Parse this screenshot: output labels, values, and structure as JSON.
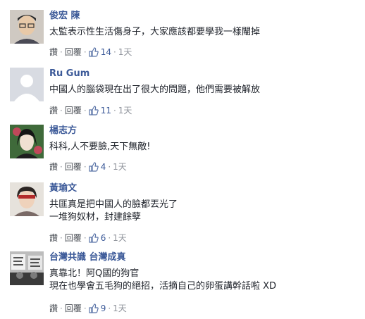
{
  "comments": [
    {
      "name": "俊宏 陳",
      "lines": [
        "太監表示性生活傷身子，大家應該都要學我一樣閹掉"
      ],
      "reply_label": "讚",
      "respond_label": "回覆",
      "likes": "14",
      "time": "1天"
    },
    {
      "name": "Ru Gum",
      "lines": [
        "中國人的腦袋現在出了很大的問題，他們需要被解放"
      ],
      "reply_label": "讚",
      "respond_label": "回覆",
      "likes": "11",
      "time": "1天"
    },
    {
      "name": "楊志方",
      "lines": [
        "科科,人不要臉,天下無敵!"
      ],
      "reply_label": "讚",
      "respond_label": "回覆",
      "likes": "4",
      "time": "1天"
    },
    {
      "name": "黃瑜文",
      "lines": [
        "共匪真是把中國人的臉都丟光了",
        "一堆狗奴材，封建餘孽"
      ],
      "reply_label": "讚",
      "respond_label": "回覆",
      "likes": "6",
      "time": "1天"
    },
    {
      "name": "台灣共識 台灣成真",
      "lines": [
        "真靠北！阿Q國的狗官",
        "現在也學會五毛狗的絕招，活摘自己的卵蛋講幹話啦 XD"
      ],
      "reply_label": "讚",
      "respond_label": "回覆",
      "likes": "9",
      "time": "1天"
    }
  ],
  "icons": {
    "like": "thumbs-up-icon",
    "separator": "·"
  },
  "colors": {
    "name": "#3b5998",
    "text": "#1d2129",
    "meta": "#90949c"
  }
}
